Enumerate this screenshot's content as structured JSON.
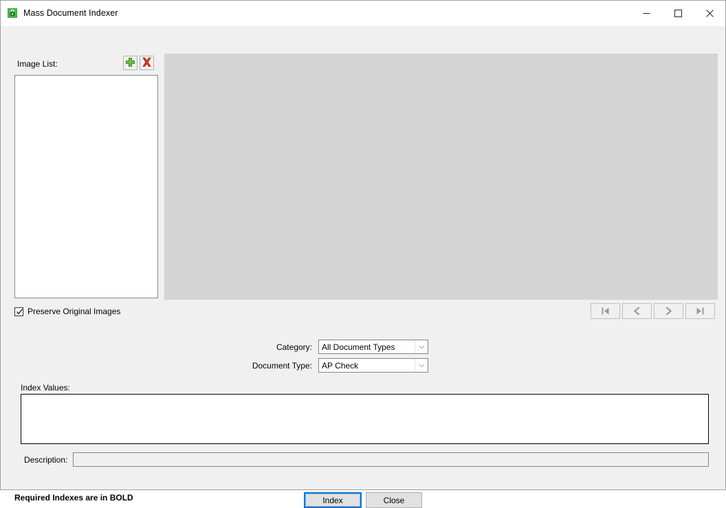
{
  "window": {
    "title": "Mass Document Indexer",
    "icon": "document-lock-icon",
    "controls": {
      "minimize": "minimize-icon",
      "maximize": "maximize-icon",
      "close": "close-icon"
    }
  },
  "image_list": {
    "label": "Image List:",
    "items": [],
    "add_button_icon": "green-plus-icon",
    "delete_button_icon": "red-x-icon"
  },
  "preview": {
    "placeholder": "",
    "background_color": "#d4d4d4"
  },
  "preserve": {
    "label": "Preserve Original Images",
    "checked": true
  },
  "navigation": {
    "first_label": "first-page-icon",
    "previous_label": "previous-page-icon",
    "next_label": "next-page-icon",
    "last_label": "last-page-icon"
  },
  "fields": {
    "category": {
      "label": "Category:",
      "value": "All Document Types",
      "options": [
        "All Document Types"
      ]
    },
    "document_type": {
      "label": "Document Type:",
      "value": "AP Check",
      "options": [
        "AP Check"
      ]
    }
  },
  "index_values": {
    "label": "Index Values:",
    "value": ""
  },
  "description": {
    "label": "Description:",
    "value": "",
    "placeholder": ""
  },
  "footer": {
    "note": "Required Indexes are in BOLD",
    "index_label": "Index",
    "close_label": "Close"
  },
  "colors": {
    "form_background": "#f0f0f0",
    "preview_background": "#d4d4d4",
    "accent": "#0078d7",
    "add_icon": "#4caf36",
    "delete_icon": "#d42a2a"
  }
}
